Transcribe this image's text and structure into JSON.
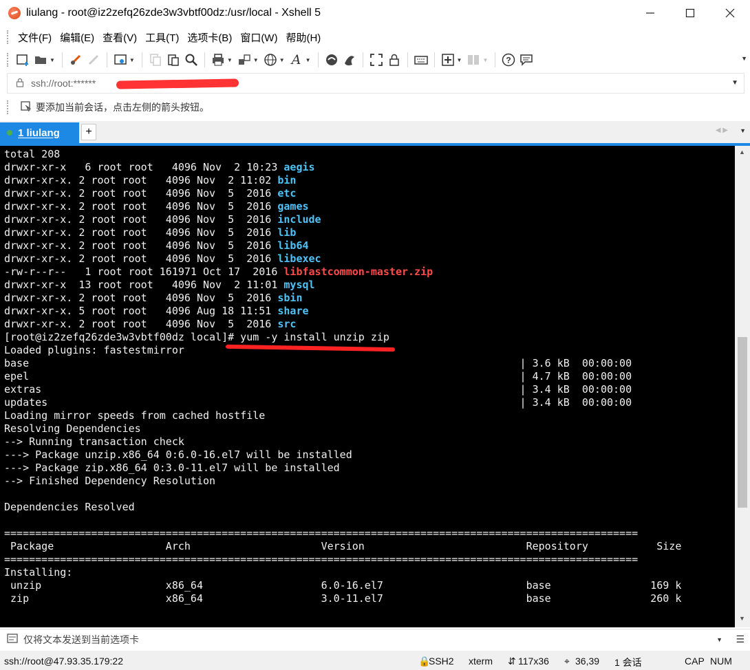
{
  "window": {
    "title": "liulang - root@iz2zefq26zde3w3vbtf00dz:/usr/local - Xshell 5",
    "app_icon": "xshell-logo-icon",
    "buttons": [
      "minimize-icon",
      "maximize-icon",
      "close-icon"
    ]
  },
  "menu": {
    "items": [
      {
        "label": "文件(F)"
      },
      {
        "label": "编辑(E)"
      },
      {
        "label": "查看(V)"
      },
      {
        "label": "工具(T)"
      },
      {
        "label": "选项卡(B)"
      },
      {
        "label": "窗口(W)"
      },
      {
        "label": "帮助(H)"
      }
    ]
  },
  "toolbar": {
    "icons": [
      "new-session-icon",
      "open-folder-icon",
      "disconnect-icon",
      "reconnect-icon",
      "properties-icon",
      "copy-icon",
      "paste-icon",
      "find-icon",
      "print-icon",
      "transfer-icon",
      "globe-icon",
      "font-icon",
      "xftp-icon",
      "xmanager-icon",
      "fullscreen-icon",
      "lock-icon",
      "keyboard-icon",
      "add-tab-icon",
      "layout-icon",
      "help-icon",
      "chat-icon"
    ]
  },
  "address": {
    "text": "ssh://root:******",
    "icon": "lock-icon"
  },
  "hint": {
    "text": "要添加当前会话，点击左侧的箭头按钮。",
    "icon": "arrow-hint-icon"
  },
  "tabs": {
    "active_label": "1 liulang",
    "add_label": "+"
  },
  "terminal": {
    "lines": [
      [
        {
          "t": "total 208"
        }
      ],
      [
        {
          "t": "drwxr-xr-x   6 root root   4096 Nov  2 10:23 "
        },
        {
          "t": "aegis",
          "c": "dir"
        }
      ],
      [
        {
          "t": "drwxr-xr-x. 2 root root   4096 Nov  2 11:02 "
        },
        {
          "t": "bin",
          "c": "dir"
        }
      ],
      [
        {
          "t": "drwxr-xr-x. 2 root root   4096 Nov  5  2016 "
        },
        {
          "t": "etc",
          "c": "dir"
        }
      ],
      [
        {
          "t": "drwxr-xr-x. 2 root root   4096 Nov  5  2016 "
        },
        {
          "t": "games",
          "c": "dir"
        }
      ],
      [
        {
          "t": "drwxr-xr-x. 2 root root   4096 Nov  5  2016 "
        },
        {
          "t": "include",
          "c": "dir"
        }
      ],
      [
        {
          "t": "drwxr-xr-x. 2 root root   4096 Nov  5  2016 "
        },
        {
          "t": "lib",
          "c": "dir"
        }
      ],
      [
        {
          "t": "drwxr-xr-x. 2 root root   4096 Nov  5  2016 "
        },
        {
          "t": "lib64",
          "c": "dir"
        }
      ],
      [
        {
          "t": "drwxr-xr-x. 2 root root   4096 Nov  5  2016 "
        },
        {
          "t": "libexec",
          "c": "dir"
        }
      ],
      [
        {
          "t": "-rw-r--r--   1 root root 161971 Oct 17  2016 "
        },
        {
          "t": "libfastcommon-master.zip",
          "c": "zip"
        }
      ],
      [
        {
          "t": "drwxr-xr-x  13 root root   4096 Nov  2 11:01 "
        },
        {
          "t": "mysql",
          "c": "dir"
        }
      ],
      [
        {
          "t": "drwxr-xr-x. 2 root root   4096 Nov  5  2016 "
        },
        {
          "t": "sbin",
          "c": "dir"
        }
      ],
      [
        {
          "t": "drwxr-xr-x. 5 root root   4096 Aug 18 11:51 "
        },
        {
          "t": "share",
          "c": "dir"
        }
      ],
      [
        {
          "t": "drwxr-xr-x. 2 root root   4096 Nov  5  2016 "
        },
        {
          "t": "src",
          "c": "dir"
        }
      ],
      [
        {
          "t": "[root@iz2zefq26zde3w3vbtf00dz local]# yum -y install unzip zip"
        }
      ],
      [
        {
          "t": "Loaded plugins: fastestmirror"
        }
      ],
      [
        {
          "t": "base                                                                               | 3.6 kB  00:00:00"
        }
      ],
      [
        {
          "t": "epel                                                                               | 4.7 kB  00:00:00"
        }
      ],
      [
        {
          "t": "extras                                                                             | 3.4 kB  00:00:00"
        }
      ],
      [
        {
          "t": "updates                                                                            | 3.4 kB  00:00:00"
        }
      ],
      [
        {
          "t": "Loading mirror speeds from cached hostfile"
        }
      ],
      [
        {
          "t": "Resolving Dependencies"
        }
      ],
      [
        {
          "t": "--> Running transaction check"
        }
      ],
      [
        {
          "t": "---> Package unzip.x86_64 0:6.0-16.el7 will be installed"
        }
      ],
      [
        {
          "t": "---> Package zip.x86_64 0:3.0-11.el7 will be installed"
        }
      ],
      [
        {
          "t": "--> Finished Dependency Resolution"
        }
      ],
      [
        {
          "t": ""
        }
      ],
      [
        {
          "t": "Dependencies Resolved"
        }
      ],
      [
        {
          "t": ""
        }
      ],
      [
        {
          "t": "======================================================================================================"
        }
      ],
      [
        {
          "t": " Package                  Arch                     Version                          Repository           Size"
        }
      ],
      [
        {
          "t": "======================================================================================================"
        }
      ],
      [
        {
          "t": "Installing:"
        }
      ],
      [
        {
          "t": " unzip                    x86_64                   6.0-16.el7                       base                169 k"
        }
      ],
      [
        {
          "t": " zip                      x86_64                   3.0-11.el7                       base                260 k"
        }
      ]
    ]
  },
  "compose": {
    "placeholder": "仅将文本发送到当前选项卡",
    "icon": "compose-icon"
  },
  "status": {
    "connection": "ssh://root@47.93.35.179:22",
    "protocol": "SSH2",
    "term": "xterm",
    "size": "117x36",
    "cursor": "36,39",
    "sessions": "1 会话",
    "cap": "CAP",
    "num": "NUM"
  }
}
